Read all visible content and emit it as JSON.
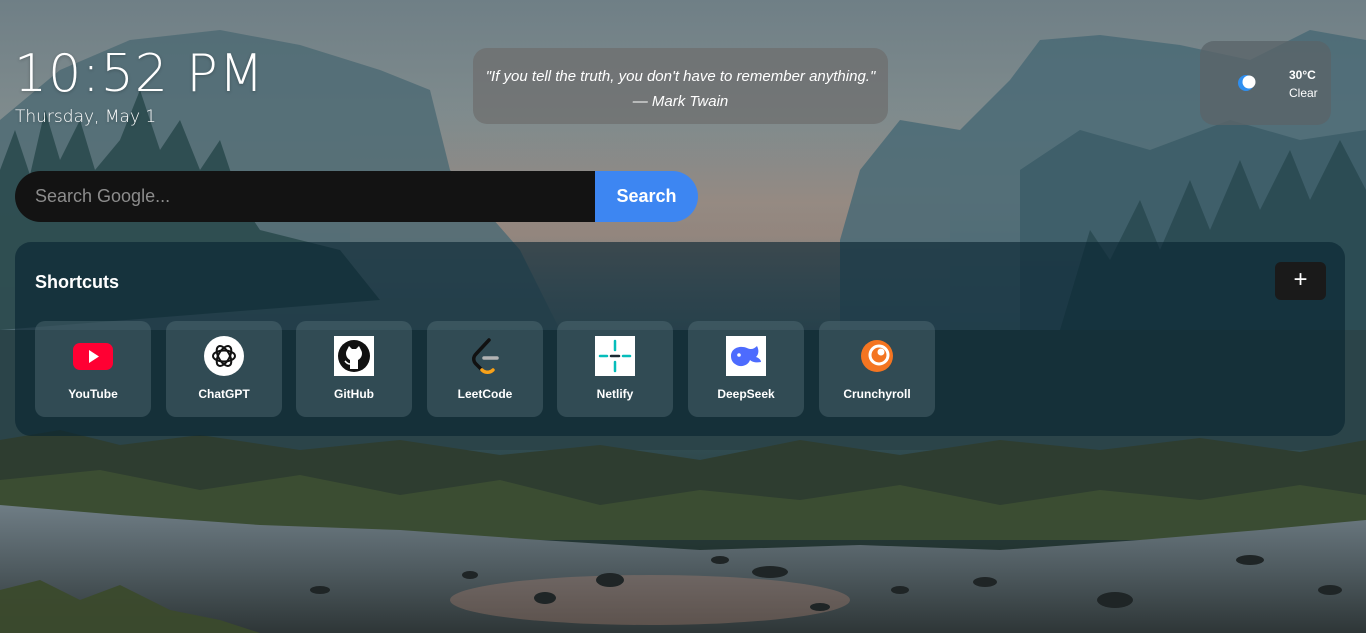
{
  "clock": {
    "time": "10:52 PM",
    "date": "Thursday, May 1"
  },
  "quote": {
    "text": "\"If you tell the truth, you don't have to remember anything.\"",
    "author": "— Mark Twain"
  },
  "weather": {
    "icon": "moon-icon",
    "temperature": "30°C",
    "condition": "Clear"
  },
  "search": {
    "placeholder": "Search Google...",
    "value": "",
    "button_label": "Search"
  },
  "shortcuts": {
    "title": "Shortcuts",
    "add_label": "+",
    "items": [
      {
        "label": "YouTube",
        "icon": "youtube-icon"
      },
      {
        "label": "ChatGPT",
        "icon": "chatgpt-icon"
      },
      {
        "label": "GitHub",
        "icon": "github-icon"
      },
      {
        "label": "LeetCode",
        "icon": "leetcode-icon"
      },
      {
        "label": "Netlify",
        "icon": "netlify-icon"
      },
      {
        "label": "DeepSeek",
        "icon": "deepseek-icon"
      },
      {
        "label": "Crunchyroll",
        "icon": "crunchyroll-icon"
      }
    ]
  },
  "colors": {
    "search_button": "#3d86f2",
    "search_input": "#131313",
    "youtube": "#ff0033",
    "crunchyroll": "#f47521",
    "deepseek": "#4d6bfe",
    "netlify": "#05bdba"
  }
}
